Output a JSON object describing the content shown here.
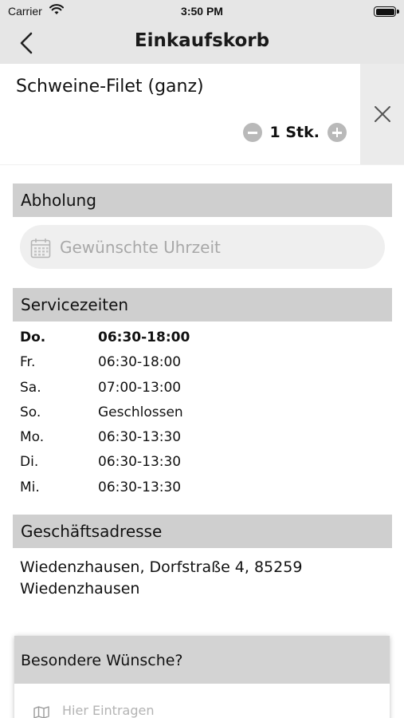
{
  "status_bar": {
    "carrier": "Carrier",
    "time": "3:50 PM",
    "icons": [
      "wifi-icon",
      "battery-icon"
    ]
  },
  "nav": {
    "title": "Einkaufskorb",
    "back_icon": "chevron-left-icon"
  },
  "cart_item": {
    "name": "Schweine-Filet (ganz)",
    "quantity_label": "1 Stk.",
    "quantity": 1,
    "icons": [
      "minus-circle-icon",
      "plus-circle-icon",
      "close-icon"
    ]
  },
  "pickup": {
    "heading": "Abholung",
    "time_placeholder": "Gewünschte Uhrzeit",
    "time_icon": "calendar-icon"
  },
  "service_hours": {
    "heading": "Servicezeiten",
    "rows": [
      {
        "day": "Do.",
        "hours": "06:30-18:00",
        "bold": true
      },
      {
        "day": "Fr.",
        "hours": "06:30-18:00",
        "bold": false
      },
      {
        "day": "Sa.",
        "hours": "07:00-13:00",
        "bold": false
      },
      {
        "day": "So.",
        "hours": "Geschlossen",
        "bold": false
      },
      {
        "day": "Mo.",
        "hours": "06:30-13:30",
        "bold": false
      },
      {
        "day": "Di.",
        "hours": "06:30-13:30",
        "bold": false
      },
      {
        "day": "Mi.",
        "hours": "06:30-13:30",
        "bold": false
      }
    ]
  },
  "address": {
    "heading": "Geschäftsadresse",
    "text": "Wiedenzhausen, Dorfstraße 4, 85259 Wiedenzhausen"
  },
  "wishes": {
    "heading": "Besondere Wünsche?",
    "placeholder": "Hier Eintragen",
    "icon": "map-icon"
  },
  "colors": {
    "bar_background": "#e6e6e6",
    "section_header": "#cfcfcf",
    "input_background": "#efefef",
    "qty_button": "#b9b9b9",
    "placeholder_text": "#a8a8a8"
  }
}
